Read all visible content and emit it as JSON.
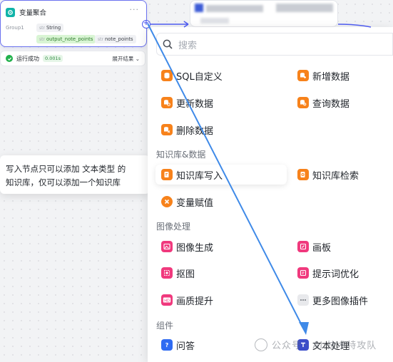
{
  "agg_node": {
    "title": "变量聚合",
    "more": "···",
    "group_label": "Group1",
    "tags": [
      {
        "type": "str",
        "name": "String"
      },
      {
        "type": "str",
        "name": "output_note_points"
      },
      {
        "type": "str",
        "name": "note_points"
      }
    ],
    "port": "+"
  },
  "run_status": {
    "text": "运行成功",
    "time": "0.001s",
    "expand_label": "展开结果"
  },
  "tooltip": {
    "line1": "写入节点只可以添加 文本类型 的",
    "line2": "知识库，仅可以添加一个知识库"
  },
  "panel": {
    "search_placeholder": "搜索",
    "database_items": [
      {
        "label": "SQL自定义",
        "icon": "database-icon"
      },
      {
        "label": "新增数据",
        "icon": "database-add-icon"
      },
      {
        "label": "更新数据",
        "icon": "database-update-icon"
      },
      {
        "label": "查询数据",
        "icon": "database-query-icon"
      },
      {
        "label": "删除数据",
        "icon": "database-delete-icon"
      }
    ],
    "knowledge_section": "知识库&数据",
    "knowledge_items": [
      {
        "label": "知识库写入",
        "icon": "knowledge-write-icon"
      },
      {
        "label": "知识库检索",
        "icon": "knowledge-search-icon"
      },
      {
        "label": "变量赋值",
        "icon": "variable-assign-icon"
      }
    ],
    "image_section": "图像处理",
    "image_items": [
      {
        "label": "图像生成",
        "icon": "image-generate-icon"
      },
      {
        "label": "画板",
        "icon": "canvas-icon"
      },
      {
        "label": "抠图",
        "icon": "cutout-icon"
      },
      {
        "label": "提示词优化",
        "icon": "prompt-optimize-icon"
      },
      {
        "label": "画质提升",
        "icon": "hd-icon"
      },
      {
        "label": "更多图像插件",
        "icon": "more-icon"
      }
    ],
    "component_section": "组件",
    "component_items": [
      {
        "label": "问答",
        "icon": "question-icon"
      },
      {
        "label": "文本处理",
        "icon": "text-process-icon"
      }
    ]
  },
  "watermark": "公众号 · AI 技术特攻队",
  "colors": {
    "accent": "#4e5bef",
    "arrow": "#3f8ae8",
    "db_orange": "#f7821b",
    "image_pink": "#f0397d",
    "success_green": "#22b14c"
  }
}
